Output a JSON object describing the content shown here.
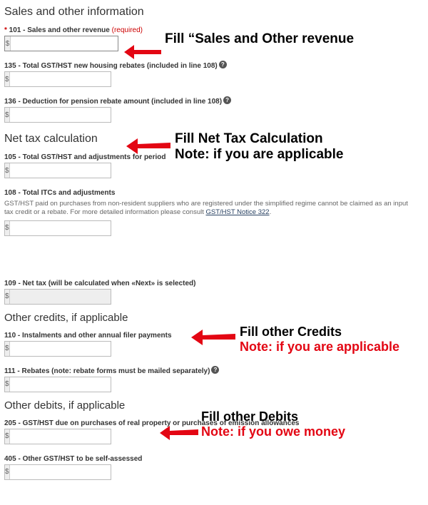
{
  "sections": {
    "sales_info": {
      "title": "Sales and other information",
      "field_101": {
        "star": "*",
        "label": " 101 - Sales and other revenue ",
        "required": "(required)"
      },
      "field_135": {
        "label": "135 - Total GST/HST new housing rebates (included in line 108) "
      },
      "field_136": {
        "label": "136 - Deduction for pension rebate amount (included in line 108) "
      }
    },
    "net_tax": {
      "title": "Net tax calculation",
      "field_105": {
        "label": "105 - Total GST/HST and adjustments for period"
      },
      "field_108": {
        "label": "108 - Total ITCs and adjustments",
        "notice_pre": "GST/HST paid on purchases from non-resident suppliers who are registered under the simplified regime cannot be claimed as an input tax credit or a rebate. For more detailed information please consult ",
        "notice_link": "GST/HST Notice 322",
        "notice_post": "."
      },
      "field_109": {
        "label": "109 - Net tax (will be calculated when «Next» is selected)"
      }
    },
    "other_credits": {
      "title": "Other credits, if applicable",
      "field_110": {
        "label": "110 - Instalments and other annual filer payments"
      },
      "field_111": {
        "label": "111 - Rebates (note: rebate forms must be mailed separately) "
      }
    },
    "other_debits": {
      "title": "Other debits, if applicable",
      "field_205": {
        "label": "205 - GST/HST due on purchases of real property or purchases of emission allowances"
      },
      "field_405": {
        "label": "405 - Other GST/HST to be self-assessed"
      }
    }
  },
  "currency": "$",
  "annotations": {
    "a1": "Fill “Sales and Other revenue",
    "a2_l1": "Fill Net Tax Calculation",
    "a2_l2": "Note: if you are applicable",
    "a3_l1": "Fill other Credits",
    "a3_l2": "Note: if you are applicable",
    "a4_l1": "Fill other Debits",
    "a4_l2": "Note: if you owe money"
  }
}
